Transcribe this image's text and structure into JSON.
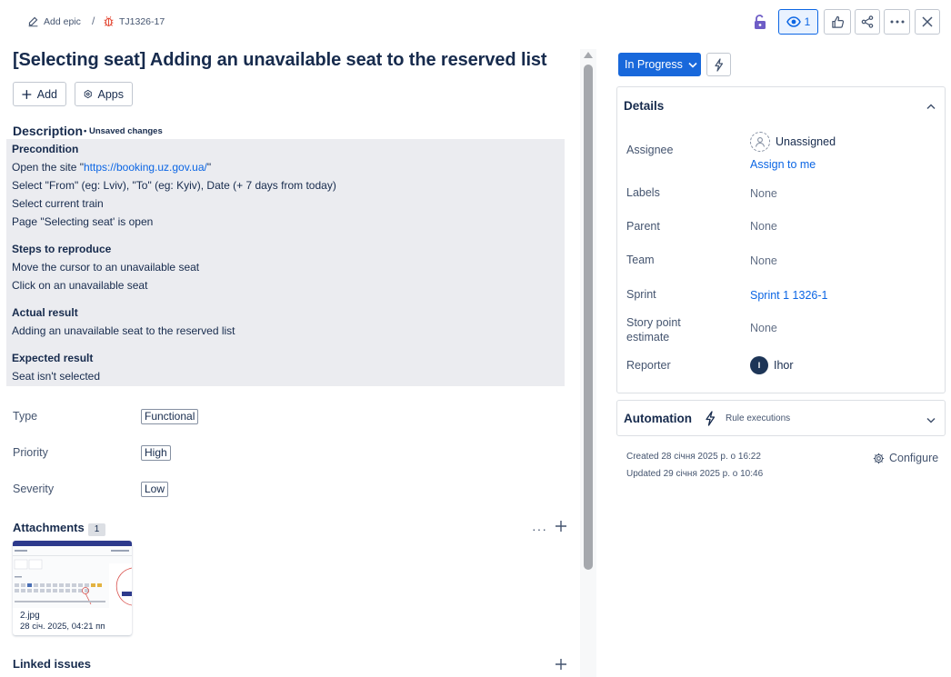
{
  "breadcrumb": {
    "epic_label": "Add epic",
    "separator": "/",
    "issue_key": "TJ1326-17"
  },
  "toolbar": {
    "watchers_count": "1",
    "icons": [
      "lock-icon",
      "eye-icon",
      "thumbs-up-icon",
      "share-icon",
      "more-icon",
      "close-icon"
    ]
  },
  "issue": {
    "title": "[Selecting seat] Adding an unavailable seat to the reserved list",
    "add_label": "Add",
    "apps_label": "Apps"
  },
  "description": {
    "heading": "Description",
    "unsaved": "• Unsaved changes",
    "precondition_h": "Precondition",
    "pre_1_prefix": "Open the site \"",
    "pre_1_link": "https://booking.uz.gov.ua/",
    "pre_1_suffix": "\"",
    "pre_2": "Select \"From\" (eg: Lviv), \"To\" (eg: Kyiv), Date (+ 7 days from today)",
    "pre_3": "Select current train",
    "pre_4": "Page \"Selecting seat' is open",
    "steps_h": "Steps to reproduce",
    "step_1": "Move the cursor to an unavailable seat",
    "step_2": "Click on an unavailable seat",
    "actual_h": "Actual result",
    "actual_1": "Adding an unavailable seat to the reserved list",
    "expected_h": "Expected result",
    "expected_1": "Seat isn't selected"
  },
  "fields": {
    "type_label": "Type",
    "type_value": "Functional",
    "priority_label": "Priority",
    "priority_value": "High",
    "severity_label": "Severity",
    "severity_value": "Low"
  },
  "attachments": {
    "heading": "Attachments",
    "count": "1",
    "more": "···",
    "file_name": "2.jpg",
    "file_date": "28 січ. 2025, 04:21 пп"
  },
  "linked": {
    "heading": "Linked issues"
  },
  "status": {
    "label": "In Progress"
  },
  "details": {
    "heading": "Details",
    "assignee_label": "Assignee",
    "assignee_value": "Unassigned",
    "assign_to_me": "Assign to me",
    "labels_label": "Labels",
    "labels_value": "None",
    "parent_label": "Parent",
    "parent_value": "None",
    "team_label": "Team",
    "team_value": "None",
    "sprint_label": "Sprint",
    "sprint_value": "Sprint 1 1326-1",
    "story_label_1": "Story point",
    "story_label_2": "estimate",
    "story_value": "None",
    "reporter_label": "Reporter",
    "reporter_initial": "I",
    "reporter_value": "Ihor"
  },
  "automation": {
    "heading": "Automation",
    "rule_executions": "Rule executions"
  },
  "meta": {
    "created": "Created 28 січня 2025 р. о 16:22",
    "updated": "Updated 29 січня 2025 р. о 10:46",
    "configure": "Configure"
  },
  "colors": {
    "primary": "#1868db",
    "link": "#0c66e4",
    "lock": "#6e5dc6",
    "bug": "#e34935"
  }
}
